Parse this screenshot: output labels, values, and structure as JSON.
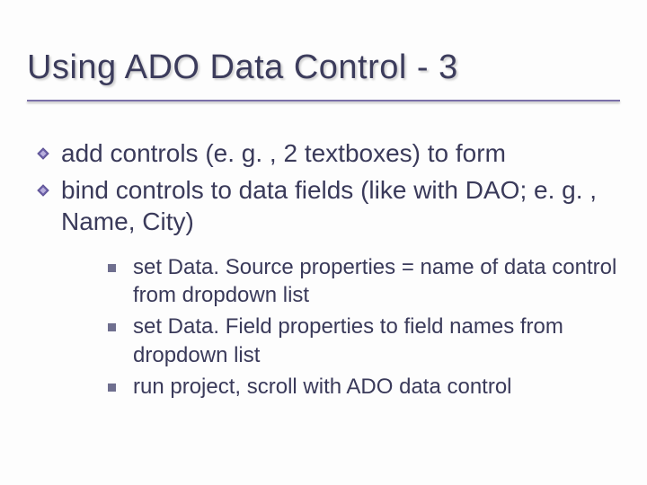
{
  "title": "Using ADO Data Control - 3",
  "bullets": {
    "level1": [
      "add controls (e. g. , 2 textboxes) to form",
      "bind controls to data fields (like with DAO; e. g. , Name, City)"
    ],
    "level2": [
      "set Data. Source properties = name of data control from dropdown list",
      "set Data. Field properties to field names from dropdown list",
      "run project, scroll with ADO data control"
    ]
  }
}
